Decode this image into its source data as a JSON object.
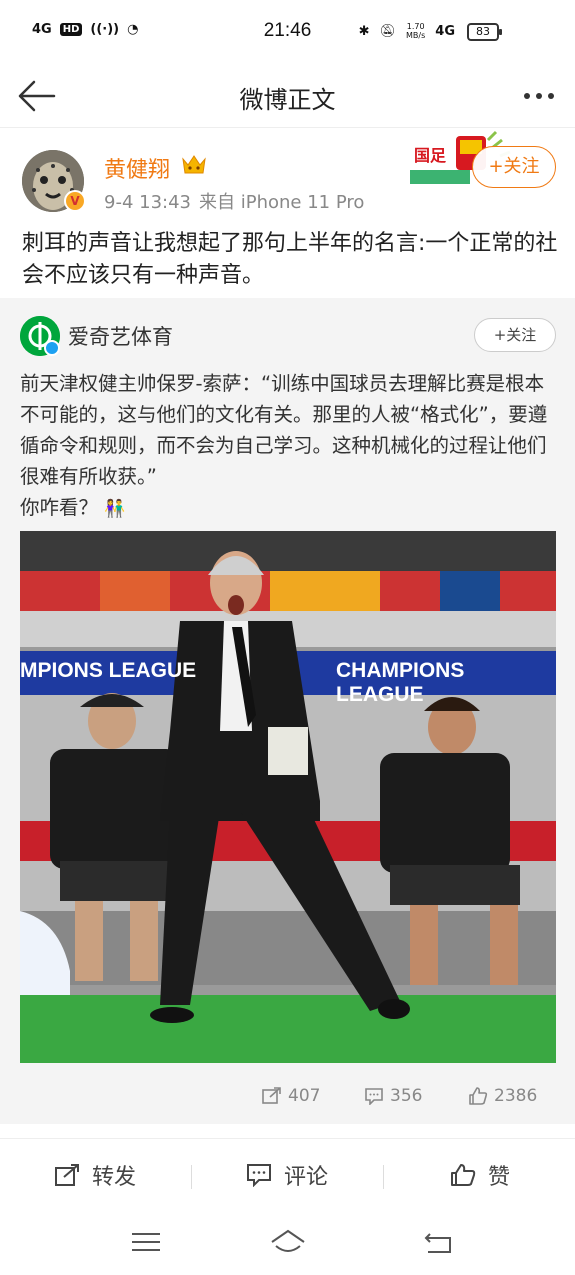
{
  "status_bar": {
    "network_left": "4G",
    "hd": "HD",
    "time": "21:46",
    "net_speed_value": "1.70",
    "net_speed_unit": "MB/s",
    "network_right": "4G",
    "battery": "83"
  },
  "header": {
    "title": "微博正文"
  },
  "post": {
    "username": "黄健翔",
    "date": "9-4 13:43",
    "source": "来自 iPhone 11 Pro",
    "follow_label": "+关注",
    "promo_text": "国足",
    "text": "刺耳的声音让我想起了那句上半年的名言:一个正常的社会不应该只有一种声音。"
  },
  "repost": {
    "author": "爱奇艺体育",
    "follow_label": "+关注",
    "text": "前天津权健主帅保罗-索萨：“训练中国球员去理解比赛是根本不可能的，这与他们的文化有关。那里的人被“格式化”，要遵循命令和规则，而不会为自己学习。这种机械化的过程让他们很难有所收获。”",
    "text2": "你咋看？",
    "image_banner_1": "MPIONS LEAGUE",
    "image_banner_2": "CHAMPIONS LEAGUE",
    "stats": {
      "reposts": "407",
      "comments": "356",
      "likes": "2386"
    }
  },
  "actions": {
    "repost": "转发",
    "comment": "评论",
    "like": "赞"
  },
  "colors": {
    "accent": "#f07a14",
    "repost_bg": "#f4f4f4",
    "iqiyi_green": "#00a63c"
  }
}
